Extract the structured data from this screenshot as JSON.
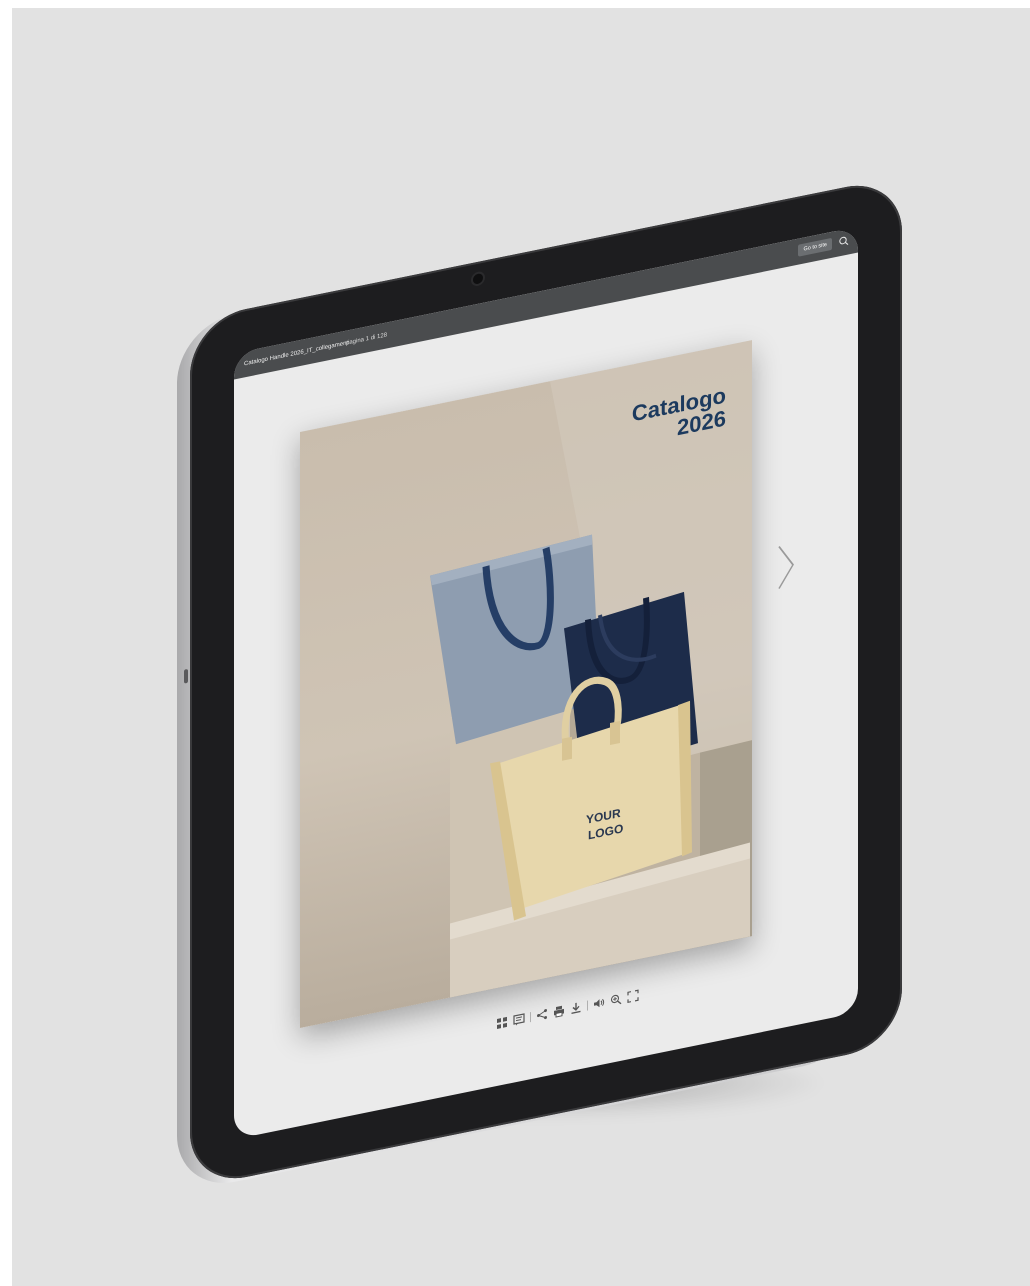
{
  "viewer": {
    "document_title": "Catalogo Handle 2026_IT_collegamenti",
    "page_counter": "pagina 1 di 128",
    "goto_label": "Go to site",
    "search_icon": "search-icon"
  },
  "page": {
    "title_line1": "Catalogo",
    "title_line2": "2026",
    "logo_line1": "YOUR",
    "logo_line2": "LOGO",
    "title_color": "#1c3a5e"
  },
  "navigation": {
    "next_icon": "chevron-right-icon"
  },
  "toolbar": {
    "icons": [
      "thumbnails-icon",
      "table-of-contents-icon",
      "share-icon",
      "print-icon",
      "download-icon",
      "sound-icon",
      "zoom-in-icon",
      "fullscreen-icon"
    ]
  },
  "colors": {
    "background": "#e2e2e2",
    "topbar": "#4a4c4e",
    "bezel": "#1d1d1f"
  }
}
